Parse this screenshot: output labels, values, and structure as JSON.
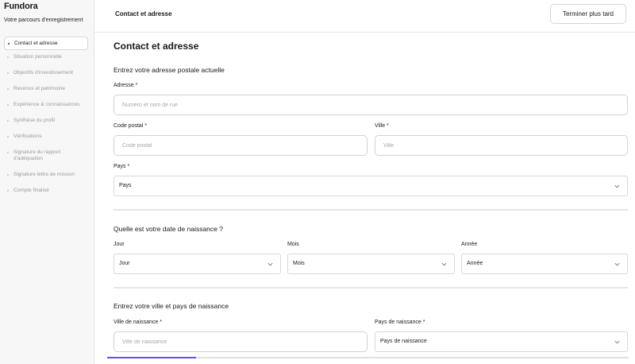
{
  "brand": {
    "name": "Fundora"
  },
  "sidebar": {
    "title": "Votre parcours d'enregistrement",
    "steps": [
      {
        "label": "Contact et adresse",
        "active": true
      },
      {
        "label": "Situation personnelle",
        "active": false
      },
      {
        "label": "Objectifs d'investissement",
        "active": false
      },
      {
        "label": "Revenus et patrimoine",
        "active": false
      },
      {
        "label": "Expérience & connaissances",
        "active": false
      },
      {
        "label": "Synthèse du profil",
        "active": false
      },
      {
        "label": "Vérifications",
        "active": false
      },
      {
        "label": "Signature du rapport d'adéquation",
        "active": false
      },
      {
        "label": "Signature lettre de mission",
        "active": false
      },
      {
        "label": "Compte finalisé",
        "active": false
      }
    ]
  },
  "header": {
    "title": "Contact et adresse",
    "finish_later_label": "Terminer plus tard"
  },
  "main": {
    "title": "Contact et adresse",
    "address_section": {
      "title": "Entrez votre adresse postale actuelle",
      "address_label": "Adresse *",
      "address_placeholder": "Numéro et nom de rue",
      "postal_label": "Code postal *",
      "postal_placeholder": "Code postal",
      "city_label": "Ville *",
      "city_placeholder": "Ville",
      "country_label": "Pays *",
      "country_value": "Pays"
    },
    "birthdate_section": {
      "title": "Quelle est votre date de naissance ?",
      "day_label": "Jour",
      "day_value": "Jour",
      "month_label": "Mois",
      "month_value": "Mois",
      "year_label": "Année",
      "year_value": "Année"
    },
    "birthplace_section": {
      "title": "Entrez votre ville et pays de naissance",
      "city_label": "Ville de naissance *",
      "city_placeholder": "Ville de naissance",
      "country_label": "Pays de naissance *",
      "country_value": "Pays de naissance"
    }
  },
  "progress": {
    "fraction": 0.17,
    "color": "#6b4de6"
  }
}
